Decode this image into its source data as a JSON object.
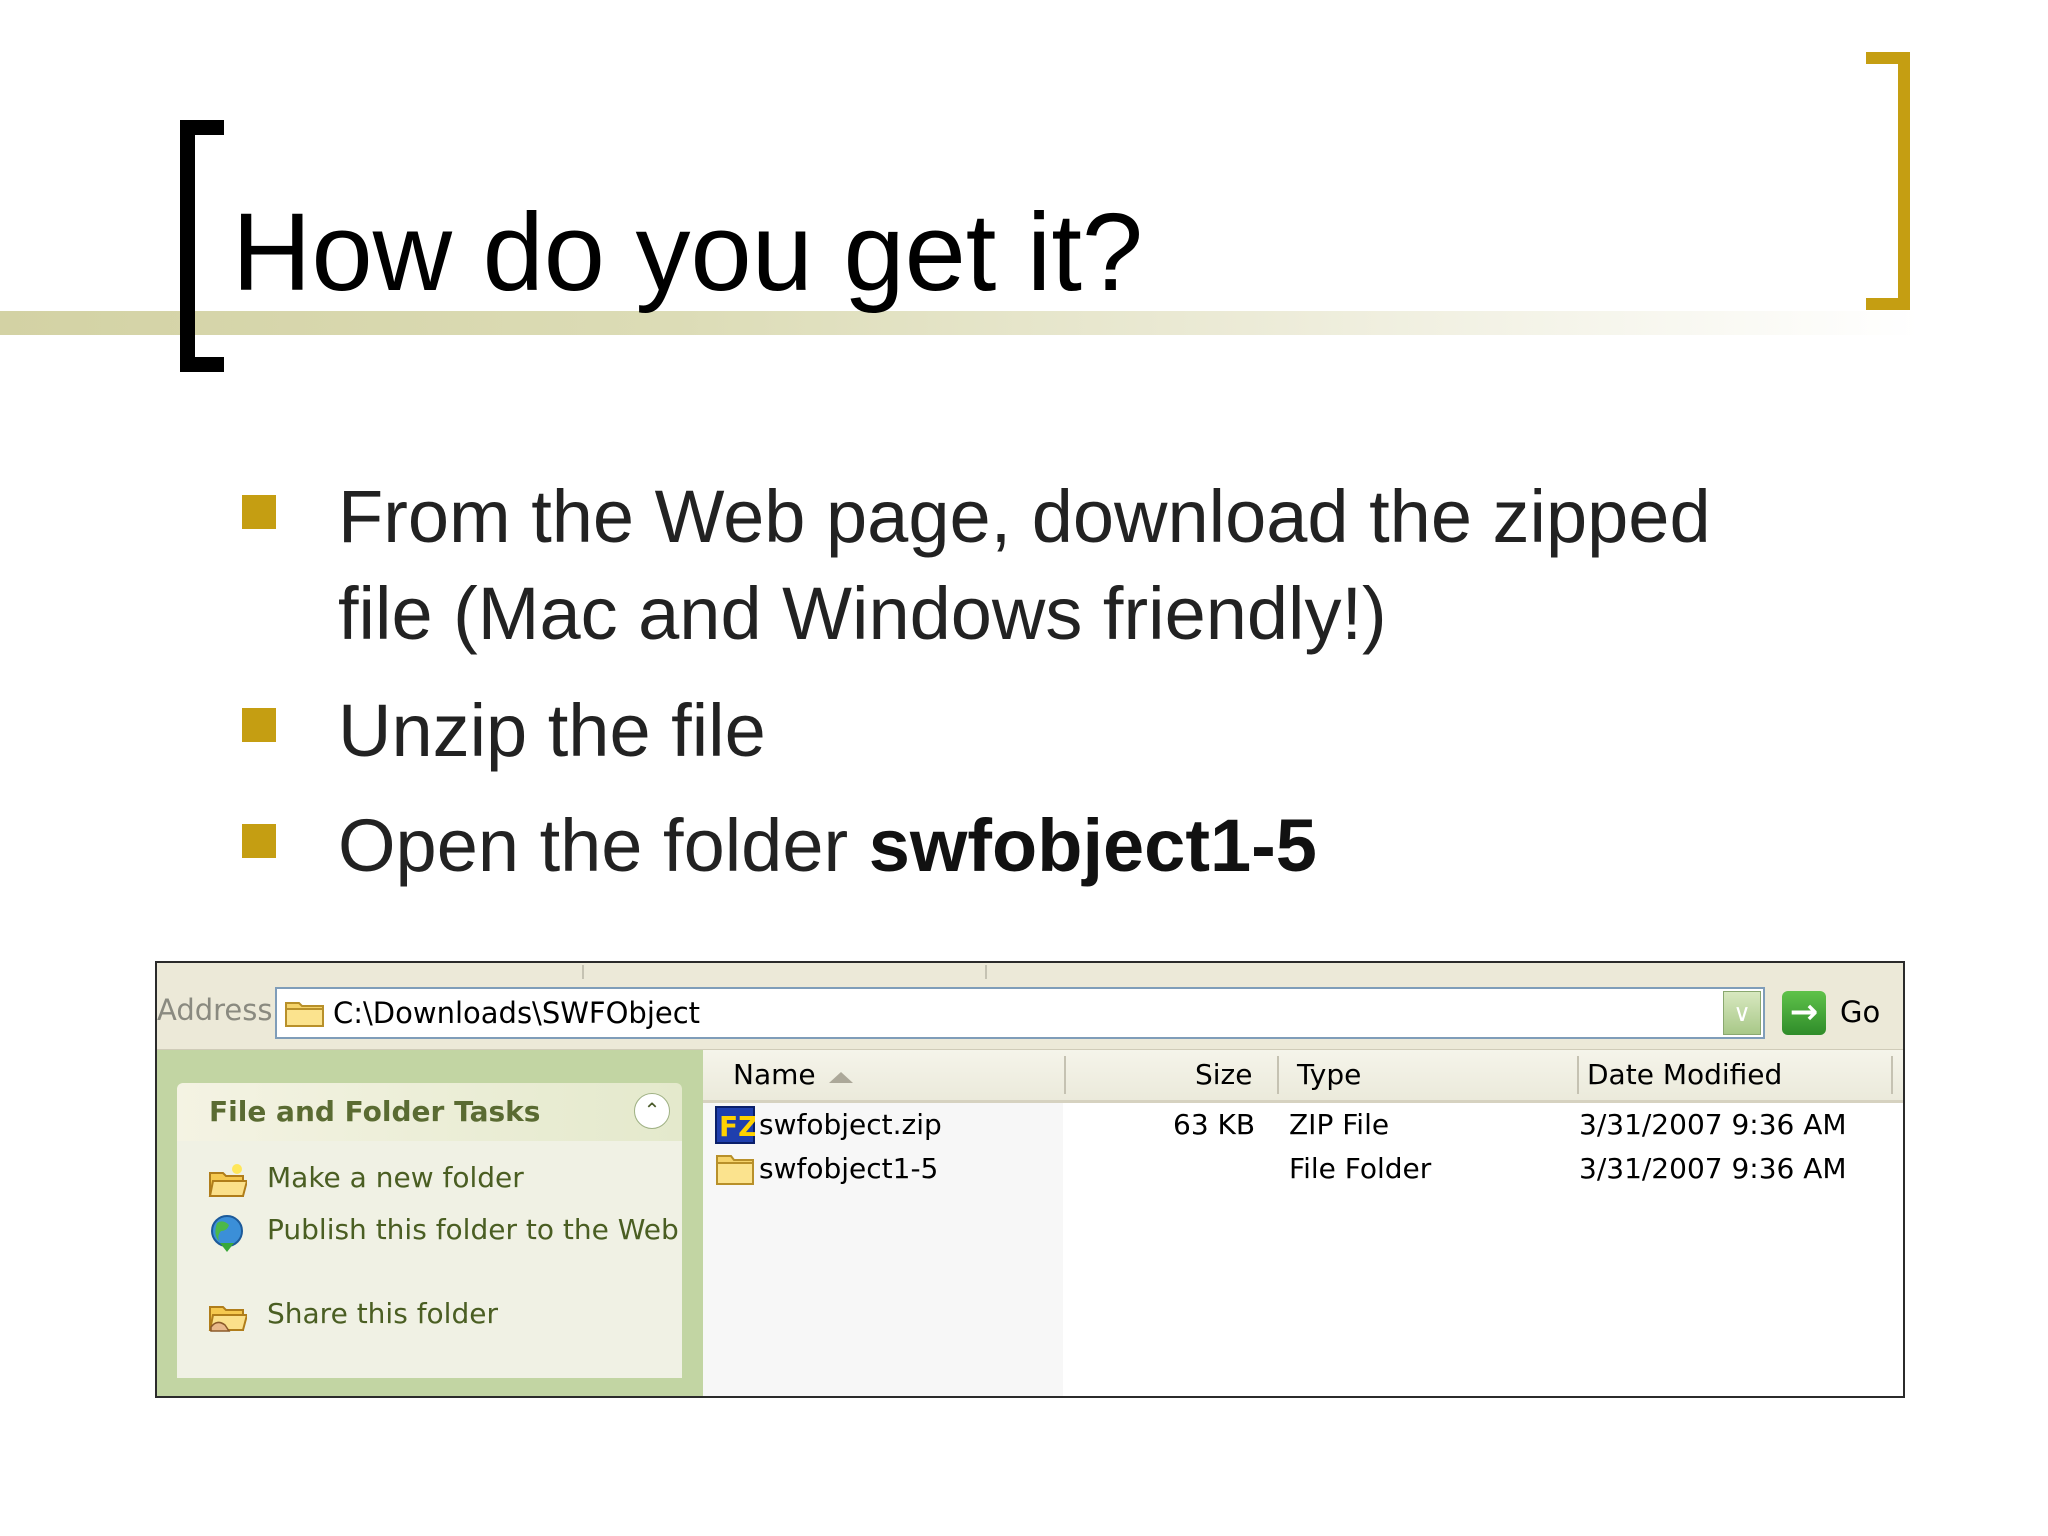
{
  "slide": {
    "title": "How do you get it?",
    "bullets": [
      {
        "line1": "From the Web page, download the zipped",
        "line2": "file (Mac and Windows friendly!)"
      },
      {
        "text": "Unzip the file"
      },
      {
        "prefix": "Open the folder ",
        "bold": "swfobject1-5"
      }
    ],
    "colors": {
      "accent": "#c59e12",
      "bracket_left": "#000000",
      "title_rule": "#d3d2a4"
    }
  },
  "explorer": {
    "address": {
      "label": "Address",
      "path": "C:\\Downloads\\SWFObject",
      "folder_icon": "folder-icon",
      "dropdown_icon": "chevron-down-icon",
      "go_label": "Go",
      "go_icon": "arrow-right-icon"
    },
    "tasks": {
      "title": "File and Folder Tasks",
      "collapse_icon": "double-chevron-up-icon",
      "items": [
        {
          "label": "Make a new folder",
          "icon": "new-folder-icon"
        },
        {
          "label": "Publish this folder to the Web",
          "icon": "globe-icon"
        },
        {
          "label": "Share this folder",
          "icon": "share-folder-icon"
        }
      ]
    },
    "columns": {
      "name": "Name",
      "size": "Size",
      "type": "Type",
      "date": "Date Modified"
    },
    "files": [
      {
        "name": "swfobject.zip",
        "size": "63 KB",
        "type": "ZIP File",
        "date": "3/31/2007 9:36 AM",
        "icon": "filezilla-zip-icon"
      },
      {
        "name": "swfobject1-5",
        "size": "",
        "type": "File Folder",
        "date": "3/31/2007 9:36 AM",
        "icon": "folder-icon"
      }
    ]
  }
}
